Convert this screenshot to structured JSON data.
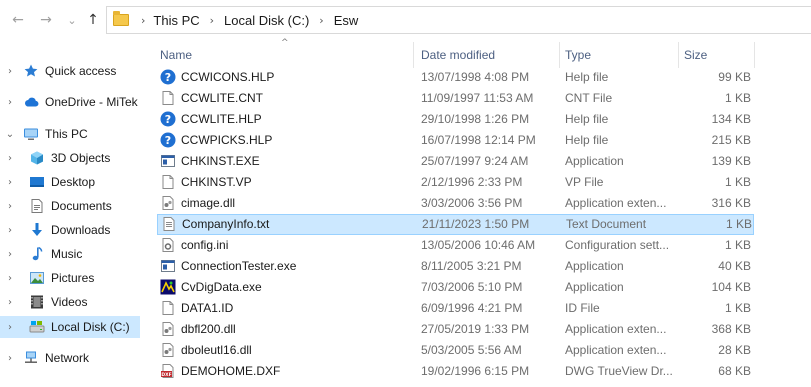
{
  "nav": {
    "back_icon": "←",
    "forward_icon": "→",
    "recent_icon": "⌄",
    "up_icon": "↑"
  },
  "breadcrumb": {
    "items": [
      "This PC",
      "Local Disk (C:)",
      "Esw"
    ],
    "separator": "›"
  },
  "sidebar": {
    "items": [
      {
        "label": "Quick access",
        "icon": "star-icon",
        "chevron": "›"
      },
      {
        "label": "OneDrive - MiTek",
        "icon": "cloud-icon",
        "chevron": "›"
      },
      {
        "label": "This PC",
        "icon": "computer-icon",
        "chevron": "⌄"
      },
      {
        "label": "3D Objects",
        "icon": "cube-icon",
        "chevron": "›"
      },
      {
        "label": "Desktop",
        "icon": "desktop-icon",
        "chevron": "›"
      },
      {
        "label": "Documents",
        "icon": "documents-icon",
        "chevron": "›"
      },
      {
        "label": "Downloads",
        "icon": "download-icon",
        "chevron": "›"
      },
      {
        "label": "Music",
        "icon": "music-icon",
        "chevron": "›"
      },
      {
        "label": "Pictures",
        "icon": "pictures-icon",
        "chevron": "›"
      },
      {
        "label": "Videos",
        "icon": "videos-icon",
        "chevron": "›"
      },
      {
        "label": "Local Disk (C:)",
        "icon": "drive-icon",
        "chevron": "›",
        "selected": true
      },
      {
        "label": "Network",
        "icon": "network-icon",
        "chevron": "›"
      }
    ]
  },
  "columns": {
    "name": "Name",
    "date": "Date modified",
    "type": "Type",
    "size": "Size",
    "sort_indicator": "^"
  },
  "files": [
    {
      "name": "CCWICONS.HLP",
      "date": "13/07/1998 4:08 PM",
      "type": "Help file",
      "size": "99 KB",
      "icon": "help-icon"
    },
    {
      "name": "CCWLITE.CNT",
      "date": "11/09/1997 11:53 AM",
      "type": "CNT File",
      "size": "1 KB",
      "icon": "file-icon"
    },
    {
      "name": "CCWLITE.HLP",
      "date": "29/10/1998 1:26 PM",
      "type": "Help file",
      "size": "134 KB",
      "icon": "help-icon"
    },
    {
      "name": "CCWPICKS.HLP",
      "date": "16/07/1998 12:14 PM",
      "type": "Help file",
      "size": "215 KB",
      "icon": "help-icon"
    },
    {
      "name": "CHKINST.EXE",
      "date": "25/07/1997 9:24 AM",
      "type": "Application",
      "size": "139 KB",
      "icon": "app-icon"
    },
    {
      "name": "CHKINST.VP",
      "date": "2/12/1996 2:33 PM",
      "type": "VP File",
      "size": "1 KB",
      "icon": "file-icon"
    },
    {
      "name": "cimage.dll",
      "date": "3/03/2006 3:56 PM",
      "type": "Application exten...",
      "size": "316 KB",
      "icon": "dll-icon"
    },
    {
      "name": "CompanyInfo.txt",
      "date": "21/11/2023 1:50 PM",
      "type": "Text Document",
      "size": "1 KB",
      "icon": "text-icon",
      "selected": true
    },
    {
      "name": "config.ini",
      "date": "13/05/2006 10:46 AM",
      "type": "Configuration sett...",
      "size": "1 KB",
      "icon": "ini-icon"
    },
    {
      "name": "ConnectionTester.exe",
      "date": "8/11/2005 3:21 PM",
      "type": "Application",
      "size": "40 KB",
      "icon": "app-icon"
    },
    {
      "name": "CvDigData.exe",
      "date": "7/03/2006 5:10 PM",
      "type": "Application",
      "size": "104 KB",
      "icon": "cvdig-icon"
    },
    {
      "name": "DATA1.ID",
      "date": "6/09/1996 4:21 PM",
      "type": "ID File",
      "size": "1 KB",
      "icon": "file-icon"
    },
    {
      "name": "dbfl200.dll",
      "date": "27/05/2019 1:33 PM",
      "type": "Application exten...",
      "size": "368 KB",
      "icon": "dll-icon"
    },
    {
      "name": "dboleutl16.dll",
      "date": "5/03/2005 5:56 AM",
      "type": "Application exten...",
      "size": "28 KB",
      "icon": "dll-icon"
    },
    {
      "name": "DEMOHOME.DXF",
      "date": "19/02/1996 6:15 PM",
      "type": "DWG TrueView Dr...",
      "size": "68 KB",
      "icon": "dxf-icon"
    }
  ],
  "colors": {
    "selection": "#cce8ff",
    "selection_border": "#99d1ff",
    "header_text": "#4d6082",
    "help_icon": "#1f6fd1"
  }
}
